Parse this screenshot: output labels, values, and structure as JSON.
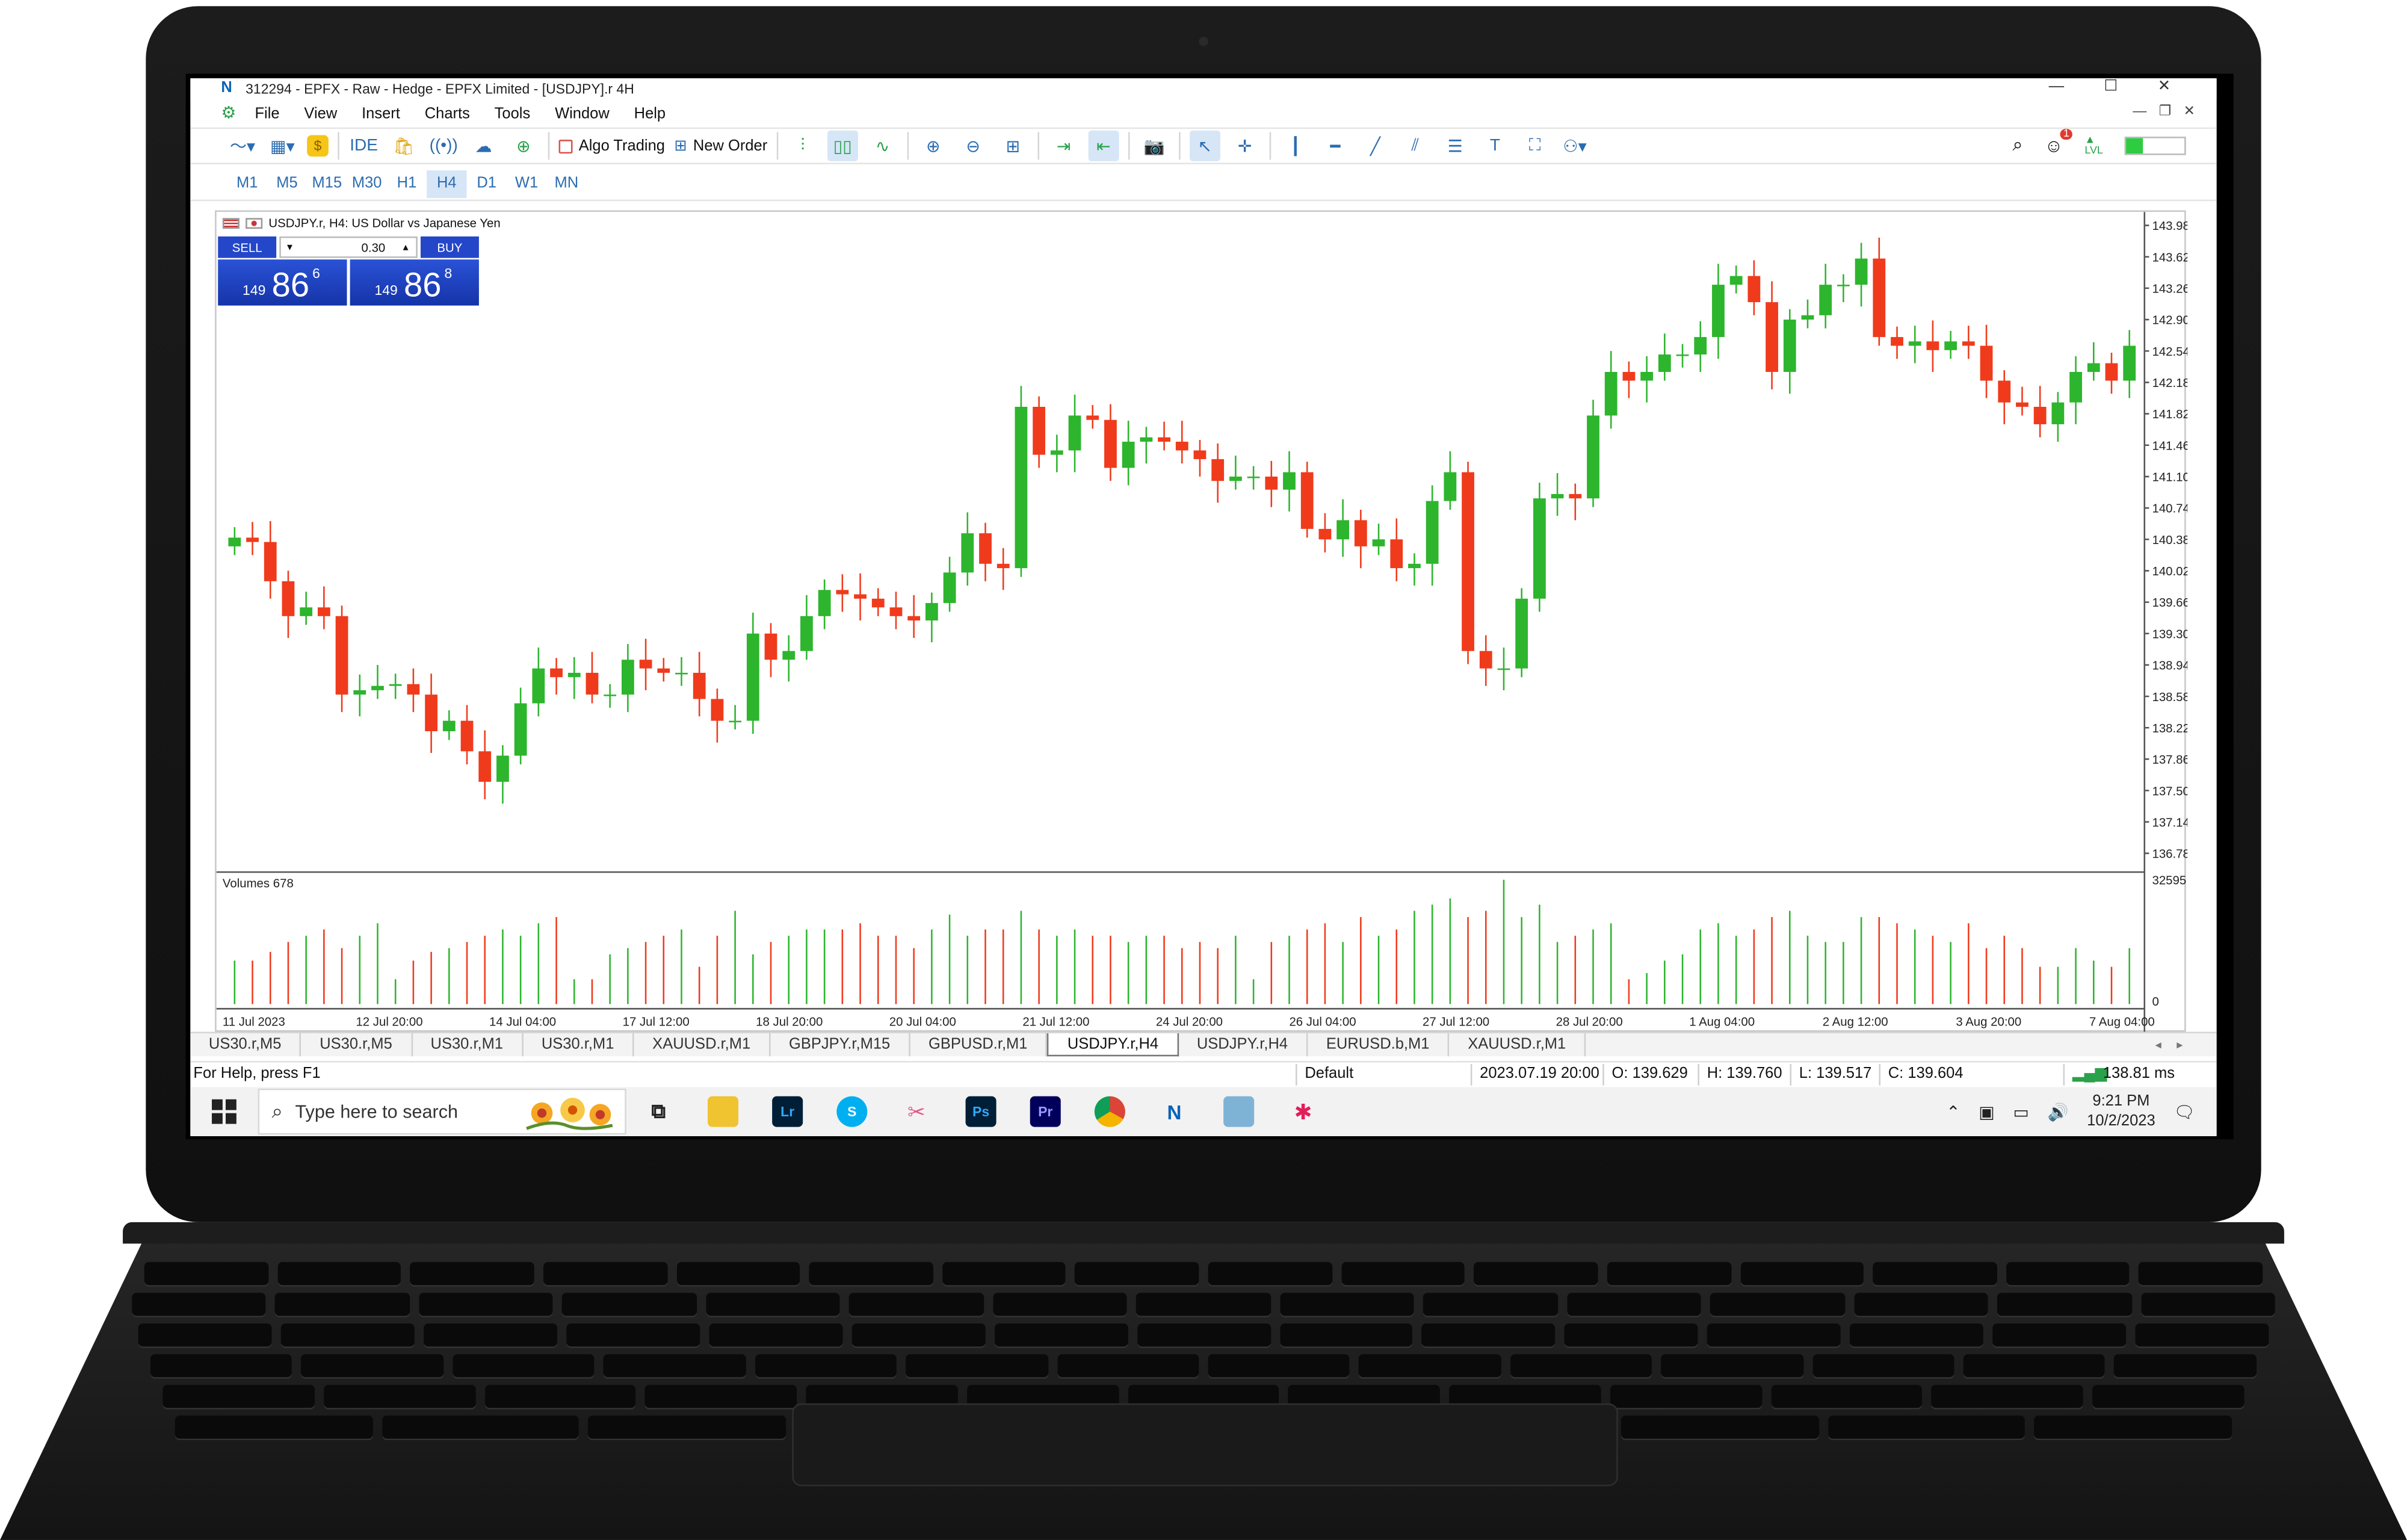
{
  "window": {
    "title": "312294 - EPFX - Raw - Hedge - EPFX Limited - [USDJPY].r 4H",
    "controls": [
      "—",
      "☐",
      "✕"
    ]
  },
  "menu": [
    "File",
    "View",
    "Insert",
    "Charts",
    "Tools",
    "Window",
    "Help"
  ],
  "toolbar": {
    "ide_label": "IDE",
    "algo_label": "Algo Trading",
    "new_order_label": "New Order",
    "notification_count": "1",
    "level_label": "LVL",
    "level_fraction": 0.3
  },
  "timeframes": [
    "M1",
    "M5",
    "M15",
    "M30",
    "H1",
    "H4",
    "D1",
    "W1",
    "MN"
  ],
  "active_timeframe": "H4",
  "chart": {
    "header": "USDJPY.r, H4:  US Dollar vs Japanese Yen",
    "sell_label": "SELL",
    "buy_label": "BUY",
    "lot_value": "0.30",
    "bid_small": "149",
    "bid_big": "86",
    "bid_sup": "6",
    "ask_small": "149",
    "ask_big": "86",
    "ask_sup": "8",
    "volumes_label": "Volumes 678"
  },
  "chart_data": {
    "type": "candlestick",
    "symbol": "USDJPY.r",
    "timeframe": "H4",
    "price_ticks": [
      "143.980",
      "143.620",
      "143.260",
      "142.900",
      "142.540",
      "142.180",
      "141.820",
      "141.460",
      "141.100",
      "140.740",
      "140.380",
      "140.020",
      "139.660",
      "139.300",
      "138.940",
      "138.580",
      "138.220",
      "137.860",
      "137.500",
      "137.140",
      "136.780"
    ],
    "volume_ticks": [
      "32595",
      "0"
    ],
    "x_ticks": [
      "11 Jul 2023",
      "12 Jul 20:00",
      "14 Jul 04:00",
      "17 Jul 12:00",
      "18 Jul 20:00",
      "20 Jul 04:00",
      "21 Jul 12:00",
      "24 Jul 20:00",
      "26 Jul 04:00",
      "27 Jul 12:00",
      "28 Jul 20:00",
      "1 Aug 04:00",
      "2 Aug 12:00",
      "3 Aug 20:00",
      "7 Aug 04:00"
    ],
    "ylim": [
      136.6,
      144.1
    ],
    "colors": {
      "up": "#2db52d",
      "down": "#ef3b1c"
    },
    "closes": [
      140.4,
      140.35,
      139.9,
      139.5,
      139.6,
      139.5,
      138.6,
      138.65,
      138.7,
      138.72,
      138.6,
      138.18,
      138.3,
      137.95,
      137.6,
      137.9,
      138.5,
      138.9,
      138.8,
      138.85,
      138.6,
      138.6,
      139.0,
      138.9,
      138.85,
      138.85,
      138.55,
      138.3,
      138.3,
      139.3,
      139.0,
      139.1,
      139.5,
      139.8,
      139.75,
      139.7,
      139.6,
      139.5,
      139.45,
      139.65,
      140.0,
      140.45,
      140.1,
      140.05,
      141.9,
      141.35,
      141.4,
      141.8,
      141.75,
      141.2,
      141.5,
      141.55,
      141.5,
      141.4,
      141.3,
      141.05,
      141.1,
      141.1,
      140.95,
      141.15,
      140.5,
      140.38,
      140.6,
      140.3,
      140.38,
      140.05,
      140.1,
      140.82,
      141.15,
      139.1,
      138.9,
      138.9,
      139.7,
      140.85,
      140.9,
      140.85,
      141.8,
      142.3,
      142.2,
      142.3,
      142.5,
      142.5,
      142.7,
      143.3,
      143.4,
      143.1,
      142.3,
      142.9,
      142.95,
      143.3,
      143.3,
      143.6,
      142.7,
      142.6,
      142.65,
      142.55,
      142.65,
      142.6,
      142.2,
      141.95,
      141.9,
      141.7,
      141.95,
      142.3,
      142.4,
      142.2,
      142.6
    ],
    "volumes": [
      0.35,
      0.35,
      0.42,
      0.5,
      0.55,
      0.6,
      0.45,
      0.55,
      0.65,
      0.2,
      0.35,
      0.42,
      0.45,
      0.5,
      0.55,
      0.6,
      0.55,
      0.65,
      0.7,
      0.2,
      0.2,
      0.4,
      0.45,
      0.5,
      0.55,
      0.6,
      0.3,
      0.55,
      0.75,
      0.4,
      0.5,
      0.55,
      0.6,
      0.6,
      0.6,
      0.65,
      0.55,
      0.55,
      0.45,
      0.6,
      0.72,
      0.55,
      0.6,
      0.6,
      0.75,
      0.6,
      0.55,
      0.6,
      0.55,
      0.55,
      0.5,
      0.55,
      0.55,
      0.45,
      0.5,
      0.45,
      0.55,
      0.2,
      0.5,
      0.55,
      0.6,
      0.65,
      0.5,
      0.7,
      0.55,
      0.6,
      0.75,
      0.8,
      0.85,
      0.7,
      0.75,
      1.0,
      0.7,
      0.8,
      0.5,
      0.55,
      0.6,
      0.65,
      0.2,
      0.25,
      0.35,
      0.4,
      0.6,
      0.65,
      0.55,
      0.6,
      0.7,
      0.75,
      0.55,
      0.5,
      0.5,
      0.7,
      0.7,
      0.65,
      0.6,
      0.55,
      0.5,
      0.65,
      0.45,
      0.55,
      0.45,
      0.3,
      0.3,
      0.45,
      0.35,
      0.3,
      0.45
    ]
  },
  "tabs": [
    "US30.r,M5",
    "US30.r,M5",
    "US30.r,M1",
    "US30.r,M1",
    "XAUUSD.r,M1",
    "GBPJPY.r,M15",
    "GBPUSD.r,M1",
    "USDJPY.r,H4",
    "USDJPY.r,H4",
    "EURUSD.b,M1",
    "XAUUSD.r,M1"
  ],
  "active_tab_index": 7,
  "status": {
    "help": "For Help, press F1",
    "profile": "Default",
    "datetime": "2023.07.19 20:00",
    "open": "O: 139.629",
    "high": "H: 139.760",
    "low": "L: 139.517",
    "close": "C: 139.604",
    "ping": "138.81 ms"
  },
  "taskbar": {
    "search_placeholder": "Type here to search",
    "apps": [
      "Lr",
      "Ps",
      "Pr"
    ],
    "time": "9:21 PM",
    "date": "10/2/2023"
  }
}
